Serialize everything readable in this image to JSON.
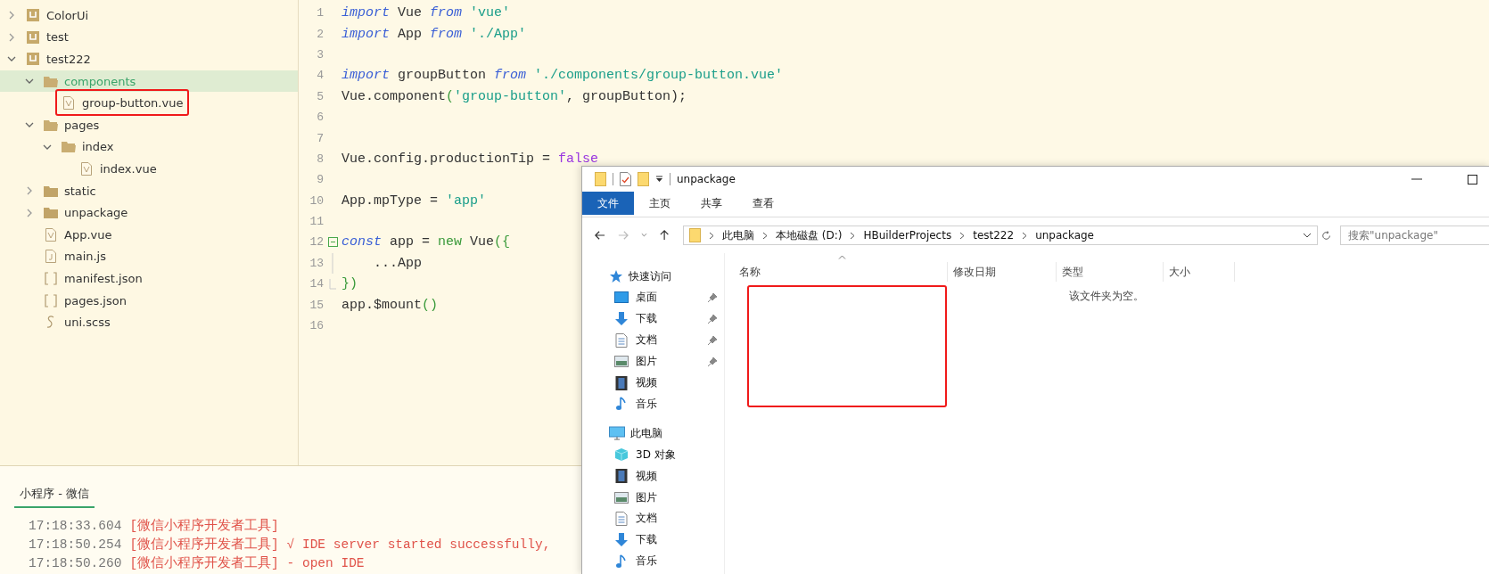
{
  "sidebar": {
    "tree": [
      {
        "name": "ColorUi",
        "kind": "project",
        "expanded": false,
        "selected": false,
        "annotated": false
      },
      {
        "name": "test",
        "kind": "project",
        "expanded": false,
        "selected": false,
        "annotated": false
      },
      {
        "name": "test222",
        "kind": "project",
        "expanded": true,
        "selected": false,
        "annotated": false,
        "children": [
          {
            "name": "components",
            "kind": "folder",
            "expanded": true,
            "selected": true,
            "annotated": false,
            "children": [
              {
                "name": "group-button.vue",
                "kind": "vue",
                "selected": false,
                "annotated": true
              }
            ]
          },
          {
            "name": "pages",
            "kind": "folder",
            "expanded": true,
            "selected": false,
            "annotated": false,
            "children": [
              {
                "name": "index",
                "kind": "folder",
                "expanded": true,
                "selected": false,
                "annotated": false,
                "children": [
                  {
                    "name": "index.vue",
                    "kind": "vue",
                    "selected": false,
                    "annotated": false
                  }
                ]
              }
            ]
          },
          {
            "name": "static",
            "kind": "folder",
            "expanded": false,
            "selected": false,
            "annotated": false
          },
          {
            "name": "unpackage",
            "kind": "folder",
            "expanded": false,
            "selected": false,
            "annotated": false
          },
          {
            "name": "App.vue",
            "kind": "vue",
            "selected": false,
            "annotated": false
          },
          {
            "name": "main.js",
            "kind": "js",
            "selected": false,
            "annotated": false
          },
          {
            "name": "manifest.json",
            "kind": "json",
            "selected": false,
            "annotated": false
          },
          {
            "name": "pages.json",
            "kind": "json",
            "selected": false,
            "annotated": false
          },
          {
            "name": "uni.scss",
            "kind": "scss",
            "selected": false,
            "annotated": false
          }
        ]
      }
    ]
  },
  "editor": {
    "lines": [
      {
        "number": "1",
        "tokens": [
          {
            "kind": "keyword",
            "text": "import"
          },
          {
            "kind": "plain",
            "text": " Vue "
          },
          {
            "kind": "keyword",
            "text": "from"
          },
          {
            "kind": "string",
            "text": " 'vue'"
          }
        ]
      },
      {
        "number": "2",
        "tokens": [
          {
            "kind": "keyword",
            "text": "import"
          },
          {
            "kind": "plain",
            "text": " App "
          },
          {
            "kind": "keyword",
            "text": "from"
          },
          {
            "kind": "string",
            "text": " './App'"
          }
        ]
      },
      {
        "number": "3"
      },
      {
        "number": "4",
        "tokens": [
          {
            "kind": "keyword",
            "text": "import"
          },
          {
            "kind": "plain",
            "text": " groupButton "
          },
          {
            "kind": "keyword",
            "text": "from"
          },
          {
            "kind": "string",
            "text": " './components/group-button.vue'"
          }
        ]
      },
      {
        "number": "5",
        "tokens": [
          {
            "kind": "plain",
            "text": "Vue.component"
          },
          {
            "kind": "punct",
            "text": "("
          },
          {
            "kind": "string",
            "text": "'group-button'"
          },
          {
            "kind": "plain",
            "text": ", groupButton);"
          }
        ]
      },
      {
        "number": "6"
      },
      {
        "number": "7"
      },
      {
        "number": "8",
        "tokens": [
          {
            "kind": "plain",
            "text": "Vue.config.productionTip = "
          },
          {
            "kind": "literal",
            "text": "false"
          }
        ]
      },
      {
        "number": "9"
      },
      {
        "number": "10",
        "tokens": [
          {
            "kind": "plain",
            "text": "App.mpType = "
          },
          {
            "kind": "string",
            "text": "'app'"
          }
        ]
      },
      {
        "number": "11"
      },
      {
        "number": "12",
        "kind": "fold-start",
        "tokens": [
          {
            "kind": "keyword",
            "text": "const"
          },
          {
            "kind": "plain",
            "text": " app = "
          },
          {
            "kind": "punct",
            "text": "new"
          },
          {
            "kind": "plain",
            "text": " Vue"
          },
          {
            "kind": "punct",
            "text": "({"
          }
        ]
      },
      {
        "number": "13",
        "kind": "fold-inside",
        "tokens": [
          {
            "kind": "plain",
            "text": "    ...App"
          }
        ]
      },
      {
        "number": "14",
        "kind": "fold-end",
        "tokens": [
          {
            "kind": "punct",
            "text": "})"
          }
        ]
      },
      {
        "number": "15",
        "tokens": [
          {
            "kind": "plain",
            "text": "app.$mount"
          },
          {
            "kind": "punct",
            "text": "()"
          }
        ]
      },
      {
        "number": "16"
      }
    ]
  },
  "console": {
    "tabs": [
      {
        "label": "小程序 - 微信",
        "selected": true
      }
    ],
    "lines": [
      {
        "time": "17:18:33.604",
        "text": "[微信小程序开发者工具]"
      },
      {
        "time": "17:18:50.254",
        "text": "[微信小程序开发者工具] √ IDE server started successfully,"
      },
      {
        "time": "17:18:50.260",
        "text": "[微信小程序开发者工具] - open IDE"
      }
    ]
  },
  "explorer": {
    "title": "unpackage",
    "ribbon_tabs": [
      {
        "label": "文件",
        "selected": true
      },
      {
        "label": "主页",
        "selected": false
      },
      {
        "label": "共享",
        "selected": false
      },
      {
        "label": "查看",
        "selected": false
      }
    ],
    "address": [
      "此电脑",
      "本地磁盘 (D:)",
      "HBuilderProjects",
      "test222",
      "unpackage"
    ],
    "search": {
      "placeholder": "搜索\"unpackage\""
    },
    "columns": [
      "名称",
      "修改日期",
      "类型",
      "大小"
    ],
    "empty_message": "该文件夹为空。",
    "annotated": true,
    "nav": [
      {
        "label": "快速访问",
        "kind": "quick",
        "children": [
          {
            "label": "桌面",
            "kind": "desktop",
            "pinned": true
          },
          {
            "label": "下载",
            "kind": "download",
            "pinned": true
          },
          {
            "label": "文档",
            "kind": "documents",
            "pinned": true
          },
          {
            "label": "图片",
            "kind": "pictures",
            "pinned": true
          },
          {
            "label": "视频",
            "kind": "videos",
            "pinned": false
          },
          {
            "label": "音乐",
            "kind": "music",
            "pinned": false
          }
        ]
      },
      {
        "label": "此电脑",
        "kind": "pc",
        "children": [
          {
            "label": "3D 对象",
            "kind": "objects3d",
            "pinned": false
          },
          {
            "label": "视频",
            "kind": "videos",
            "pinned": false
          },
          {
            "label": "图片",
            "kind": "pictures",
            "pinned": false
          },
          {
            "label": "文档",
            "kind": "documents",
            "pinned": false
          },
          {
            "label": "下载",
            "kind": "download",
            "pinned": false
          },
          {
            "label": "音乐",
            "kind": "music",
            "pinned": false
          }
        ]
      }
    ]
  }
}
